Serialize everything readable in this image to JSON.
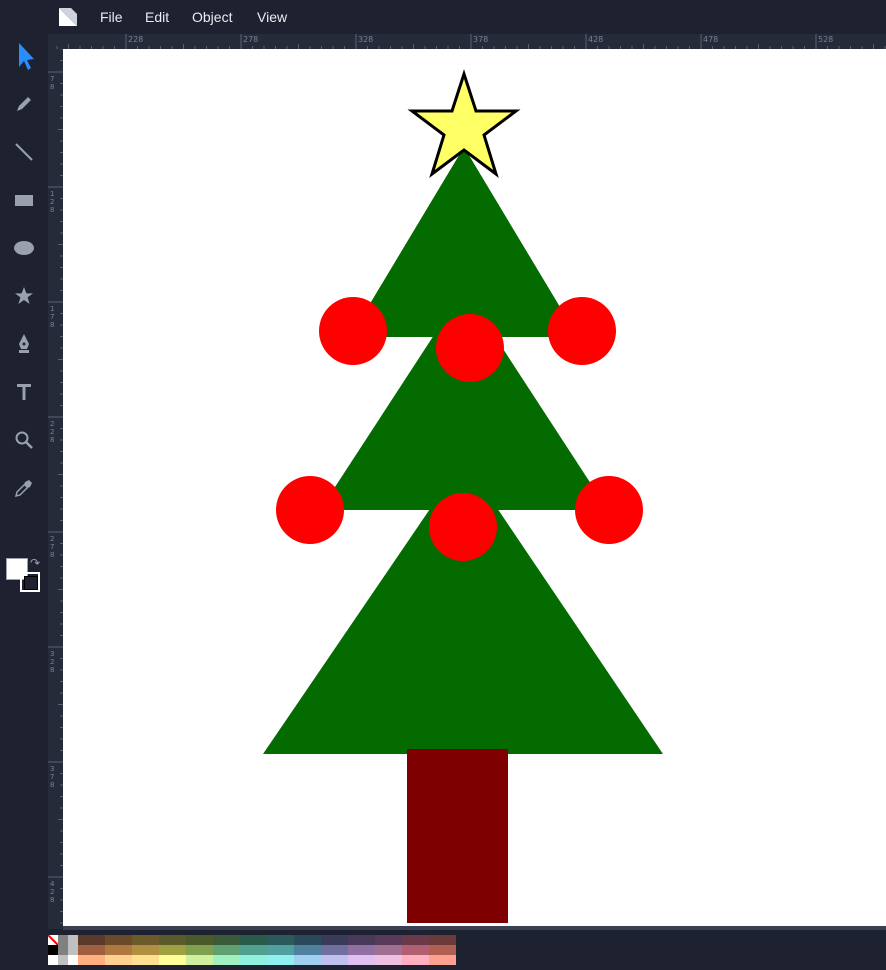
{
  "app": {
    "menu": [
      "File",
      "Edit",
      "Object",
      "View"
    ]
  },
  "toolbar": {
    "tools": [
      {
        "name": "select-tool",
        "icon": "pointer-arrow-icon",
        "active": true
      },
      {
        "name": "pencil-tool",
        "icon": "pencil-icon"
      },
      {
        "name": "line-tool",
        "icon": "line-icon"
      },
      {
        "name": "rectangle-tool",
        "icon": "rectangle-icon"
      },
      {
        "name": "ellipse-tool",
        "icon": "ellipse-icon"
      },
      {
        "name": "star-tool",
        "icon": "star-icon"
      },
      {
        "name": "pen-tool",
        "icon": "pen-nib-icon"
      },
      {
        "name": "text-tool",
        "icon": "text-icon"
      },
      {
        "name": "zoom-tool",
        "icon": "magnifier-icon"
      },
      {
        "name": "eyedropper-tool",
        "icon": "eyedropper-icon"
      }
    ],
    "fill_color": "#ffffff",
    "stroke_color": "#000000"
  },
  "ruler": {
    "top_labels": [
      "228",
      "278",
      "328",
      "378",
      "428",
      "478",
      "528"
    ],
    "left_labels": [
      "78",
      "128",
      "178",
      "228",
      "278",
      "328",
      "378",
      "428"
    ]
  },
  "canvas": {
    "tree_color": "#036b00",
    "trunk_color": "#7f0000",
    "ornament_color": "#ff0000",
    "star_fill": "#ffff66",
    "star_stroke": "#000000"
  },
  "palette": {
    "colors": [
      "#5a3a2a",
      "#6b4a2a",
      "#6b5a2a",
      "#5a5a2a",
      "#4a5a2a",
      "#3a5a3a",
      "#2a5a4a",
      "#2a5a5a",
      "#2a4a5a",
      "#3a3a5a",
      "#4a3a5a",
      "#5a3a5a",
      "#6b3a4a",
      "#6b3a3a",
      "#a06040",
      "#b07840",
      "#b09040",
      "#a0a040",
      "#80a050",
      "#60a070",
      "#50a090",
      "#50a0a0",
      "#5080a0",
      "#7070a0",
      "#9070a0",
      "#a07090",
      "#b06070",
      "#b06050",
      "#ffb080",
      "#ffd090",
      "#ffe090",
      "#ffff99",
      "#d0f0a0",
      "#a0f0c0",
      "#90f0e0",
      "#90f0f0",
      "#a0d0f0",
      "#c0c0f0",
      "#e0c0f0",
      "#f0c0e0",
      "#ffb0c0",
      "#ffa090"
    ],
    "grays": [
      "#000000",
      "#808080",
      "#c0c0c0",
      "#ffffff"
    ]
  }
}
